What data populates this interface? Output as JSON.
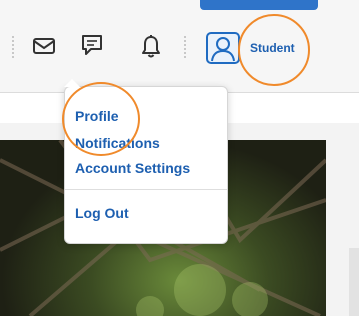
{
  "header": {
    "icons": [
      "envelope-icon",
      "chat-icon",
      "bell-icon",
      "user-icon"
    ],
    "username": "Student",
    "accent_color": "#1d5fb0",
    "highlight_color": "#f08a2b"
  },
  "user_menu": {
    "items": [
      {
        "label": "Profile"
      },
      {
        "label": "Notifications"
      },
      {
        "label": "Account Settings"
      },
      {
        "label": "Log Out"
      }
    ]
  }
}
